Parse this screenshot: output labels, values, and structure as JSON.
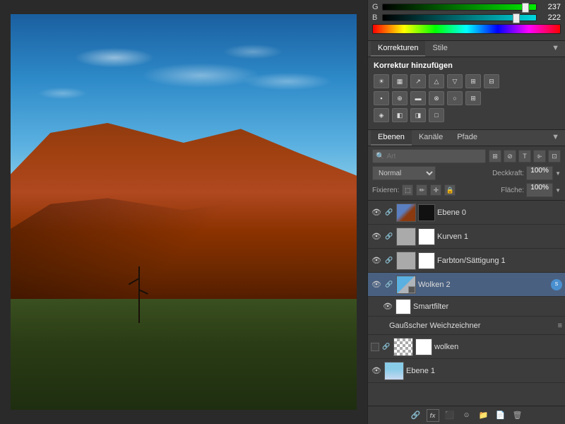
{
  "canvas": {
    "alt": "Uluru landscape photo"
  },
  "color_panel": {
    "g_label": "G",
    "b_label": "B",
    "g_value": "237",
    "b_value": "222",
    "g_percent": 93,
    "b_percent": 87
  },
  "tabs_korr": {
    "tab1": "Korrekturen",
    "tab2": "Stile",
    "title": "Korrektur hinzufügen"
  },
  "tabs_ebenen": {
    "tab1": "Ebenen",
    "tab2": "Kanäle",
    "tab3": "Pfade"
  },
  "layer_controls": {
    "search_placeholder": "Art",
    "blend_mode": "Normal",
    "opacity_label": "Deckkraft:",
    "opacity_value": "100%",
    "fix_label": "Fixieren:",
    "flaeche_label": "Fläche:",
    "flaeche_value": "100%"
  },
  "layers": [
    {
      "id": "ebene0",
      "name": "Ebene 0",
      "visible": true,
      "has_link": true,
      "thumb_class": "thumb-ebene0",
      "has_mask": true,
      "active": false,
      "indent": 0
    },
    {
      "id": "kurven1",
      "name": "Kurven 1",
      "visible": true,
      "has_link": true,
      "thumb_class": "thumb-kurven",
      "has_mask": true,
      "active": false,
      "indent": 0
    },
    {
      "id": "farbton1",
      "name": "Farbton/Sättigung 1",
      "visible": true,
      "has_link": true,
      "thumb_class": "thumb-farbton",
      "has_mask": true,
      "active": false,
      "indent": 0
    },
    {
      "id": "wolken2",
      "name": "Wolken 2",
      "visible": true,
      "has_link": true,
      "thumb_class": "thumb-wolken2",
      "has_mask": false,
      "active": true,
      "indent": 0
    },
    {
      "id": "smartfilter",
      "name": "Smartfilter",
      "visible": true,
      "has_link": false,
      "thumb_class": "thumb-smartfilter",
      "has_mask": false,
      "active": false,
      "indent": 1,
      "is_sub": true
    },
    {
      "id": "gaussweich",
      "name": "Gaußscher Weichzeichner",
      "visible": false,
      "has_link": false,
      "thumb_class": "",
      "has_mask": false,
      "active": false,
      "indent": 2,
      "is_filter": true
    },
    {
      "id": "wolken",
      "name": "wolken",
      "visible": false,
      "has_link": true,
      "thumb_class": "thumb-wolken-checker",
      "has_mask": true,
      "active": false,
      "indent": 0,
      "unchecked": true
    },
    {
      "id": "ebene1",
      "name": "Ebene 1",
      "visible": true,
      "has_link": false,
      "thumb_class": "thumb-ebene1",
      "has_mask": false,
      "active": false,
      "indent": 0
    }
  ],
  "bottom_toolbar": {
    "icons": [
      "🔗",
      "fx",
      "⬛",
      "⊙",
      "📁",
      "🗑"
    ]
  }
}
